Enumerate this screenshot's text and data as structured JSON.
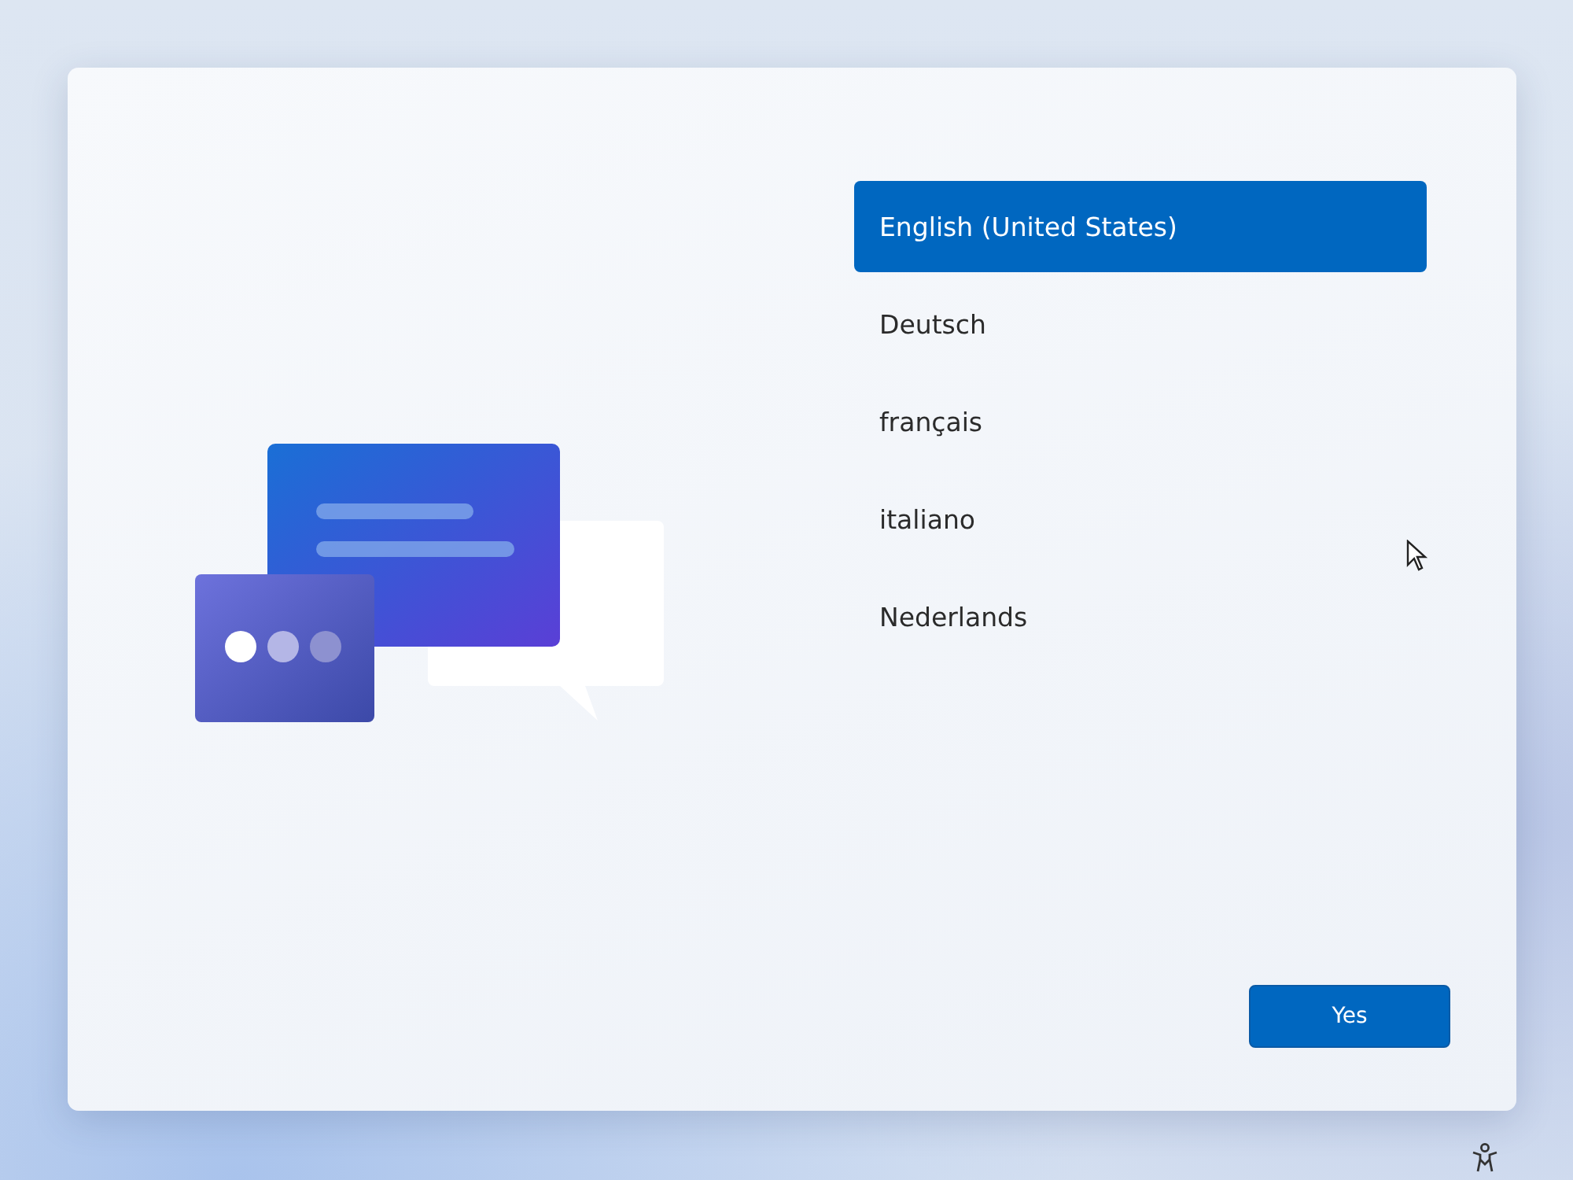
{
  "languages": [
    {
      "label": "English (United States)",
      "selected": true
    },
    {
      "label": "Deutsch",
      "selected": false
    },
    {
      "label": "français",
      "selected": false
    },
    {
      "label": "italiano",
      "selected": false
    },
    {
      "label": "Nederlands",
      "selected": false
    }
  ],
  "buttons": [
    {
      "label": "Yes"
    }
  ]
}
